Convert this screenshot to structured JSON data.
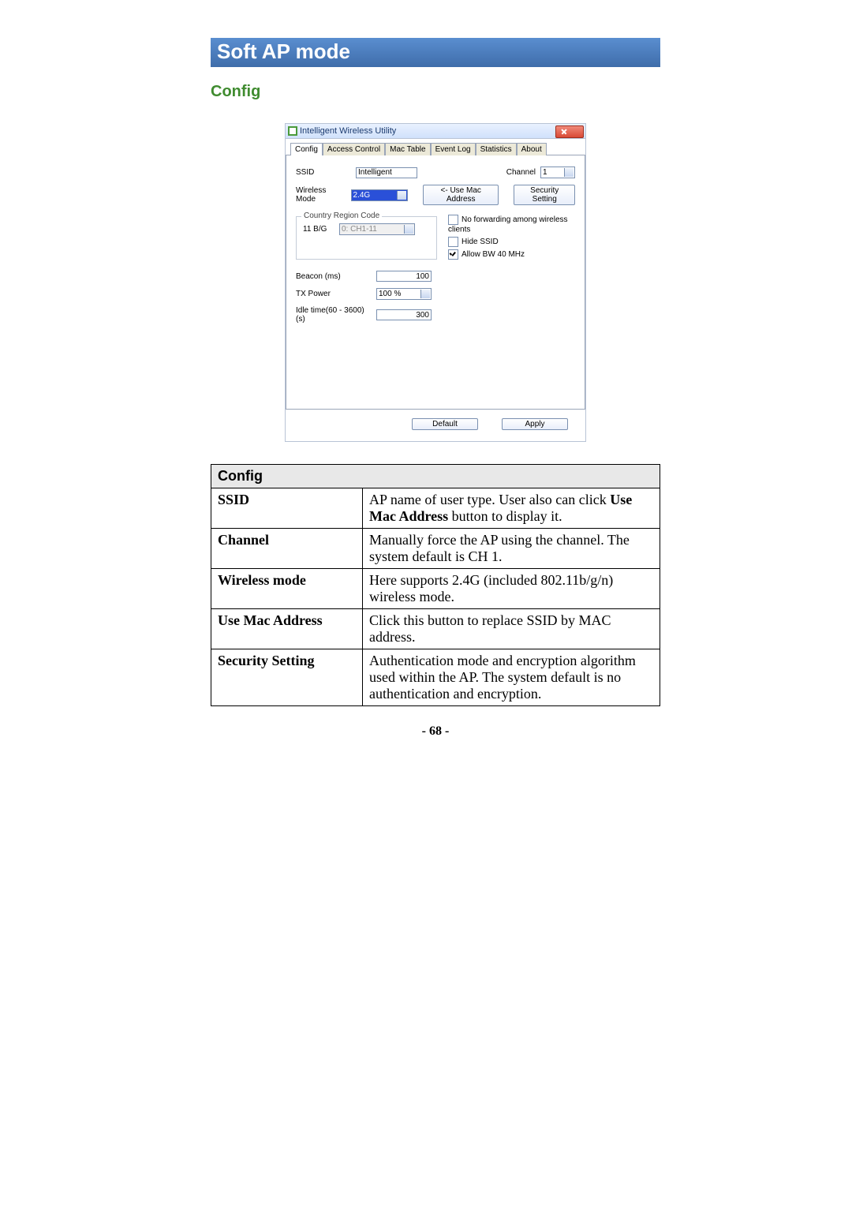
{
  "headings": {
    "section": "Soft AP mode",
    "subsection": "Config",
    "page_number": "- 68 -"
  },
  "dialog": {
    "title": "Intelligent Wireless Utility",
    "tabs": [
      "Config",
      "Access Control",
      "Mac Table",
      "Event Log",
      "Statistics",
      "About"
    ],
    "active_tab": "Config",
    "fields": {
      "ssid_label": "SSID",
      "ssid_value": "Intelligent",
      "channel_label": "Channel",
      "channel_value": "1",
      "wireless_mode_label": "Wireless Mode",
      "wireless_mode_value": "2.4G",
      "use_mac_button": "<- Use Mac Address",
      "security_button": "Security Setting",
      "region_legend": "Country Region Code",
      "region_band_label": "11 B/G",
      "region_value": "0: CH1-11",
      "cb_noforward": "No forwarding among wireless clients",
      "cb_hide": "Hide SSID",
      "cb_bw40": "Allow BW 40 MHz",
      "beacon_label": "Beacon (ms)",
      "beacon_value": "100",
      "txpower_label": "TX Power",
      "txpower_value": "100 %",
      "idle_label": "Idle time(60 - 3600)(s)",
      "idle_value": "300",
      "default_button": "Default",
      "apply_button": "Apply"
    }
  },
  "table": {
    "header": "Config",
    "rows": [
      {
        "k": "SSID",
        "v_pre": "AP name of user type. User also can click ",
        "v_b": "Use Mac Address",
        "v_post": " button to display it."
      },
      {
        "k": "Channel",
        "v": "Manually force the AP using the channel. The system default is CH 1."
      },
      {
        "k": "Wireless mode",
        "v": "Here supports 2.4G (included 802.11b/g/n) wireless mode."
      },
      {
        "k": "Use Mac Address",
        "v": "Click this button to replace SSID by MAC address."
      },
      {
        "k": "Security Setting",
        "v": "Authentication mode and encryption algorithm used within the AP. The system default is no authentication and encryption."
      }
    ]
  }
}
